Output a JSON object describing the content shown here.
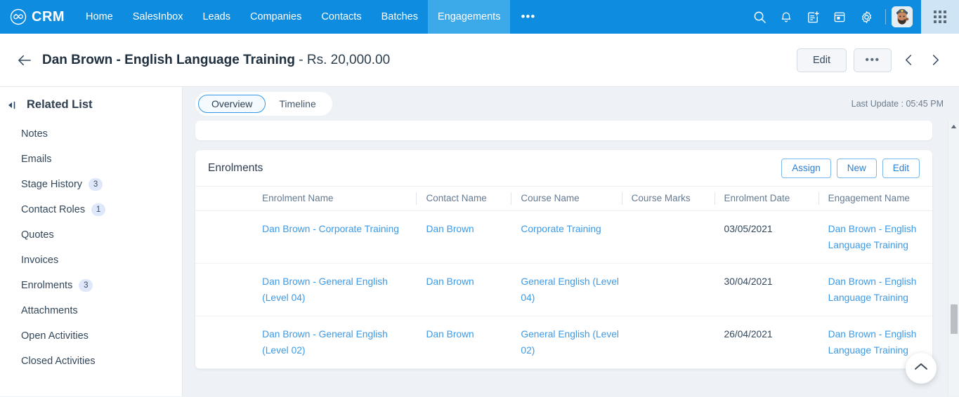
{
  "topnav": {
    "brand": "CRM",
    "brand_icon": "infinity-logo-icon",
    "items": [
      {
        "label": "Home",
        "active": false
      },
      {
        "label": "SalesInbox",
        "active": false
      },
      {
        "label": "Leads",
        "active": false
      },
      {
        "label": "Companies",
        "active": false
      },
      {
        "label": "Contacts",
        "active": false
      },
      {
        "label": "Batches",
        "active": false
      },
      {
        "label": "Engagements",
        "active": true
      }
    ],
    "more_label": "•••",
    "icons": [
      "search-icon",
      "notification-bell-icon",
      "add-note-icon",
      "calendar-icon",
      "settings-gear-icon"
    ],
    "avatar_alt": "user-avatar",
    "app_launcher": "grid-apps-icon",
    "bg_color": "#0e8ce0",
    "active_bg_color": "#3ca9e9"
  },
  "pagehead": {
    "back_icon": "back-arrow-icon",
    "title_main": "Dan Brown - English Language Training",
    "title_amount": " - Rs. 20,000.00",
    "edit_label": "Edit",
    "more_label": "•••",
    "prev_icon": "chevron-left-icon",
    "next_icon": "chevron-right-icon"
  },
  "sidebar": {
    "collapse_icon": "collapse-panel-icon",
    "title": "Related List",
    "items": [
      {
        "label": "Notes",
        "count": ""
      },
      {
        "label": "Emails",
        "count": ""
      },
      {
        "label": "Stage History",
        "count": "3"
      },
      {
        "label": "Contact Roles",
        "count": "1"
      },
      {
        "label": "Quotes",
        "count": ""
      },
      {
        "label": "Invoices",
        "count": ""
      },
      {
        "label": "Enrolments",
        "count": "3"
      },
      {
        "label": "Attachments",
        "count": ""
      },
      {
        "label": "Open Activities",
        "count": ""
      },
      {
        "label": "Closed Activities",
        "count": ""
      }
    ]
  },
  "main": {
    "tabs": [
      {
        "label": "Overview",
        "active": true
      },
      {
        "label": "Timeline",
        "active": false
      }
    ],
    "last_update": "Last Update : 05:45 PM",
    "scroll_top_icon": "chevron-up-icon",
    "scrollbar_up_icon": "scroll-up-arrow-icon"
  },
  "enrolments": {
    "title": "Enrolments",
    "buttons": [
      {
        "label": "Assign"
      },
      {
        "label": "New"
      },
      {
        "label": "Edit"
      }
    ],
    "columns": [
      "Enrolment Name",
      "Contact Name",
      "Course Name",
      "Course Marks",
      "Enrolment Date",
      "Engagement Name"
    ],
    "rows": [
      {
        "enrolment_name": "Dan Brown - Corporate Training",
        "contact_name": "Dan Brown",
        "course_name": "Corporate Training",
        "course_marks": "",
        "enrolment_date": "03/05/2021",
        "engagement_name": "Dan Brown - English Language Training"
      },
      {
        "enrolment_name": "Dan Brown - General English (Level 04)",
        "contact_name": "Dan Brown",
        "course_name": "General English (Level 04)",
        "course_marks": "",
        "enrolment_date": "30/04/2021",
        "engagement_name": "Dan Brown - English Language Training"
      },
      {
        "enrolment_name": "Dan Brown - General English (Level 02)",
        "contact_name": "Dan Brown",
        "course_name": "General English (Level 02)",
        "course_marks": "",
        "enrolment_date": "26/04/2021",
        "engagement_name": "Dan Brown - English Language Training"
      }
    ]
  }
}
